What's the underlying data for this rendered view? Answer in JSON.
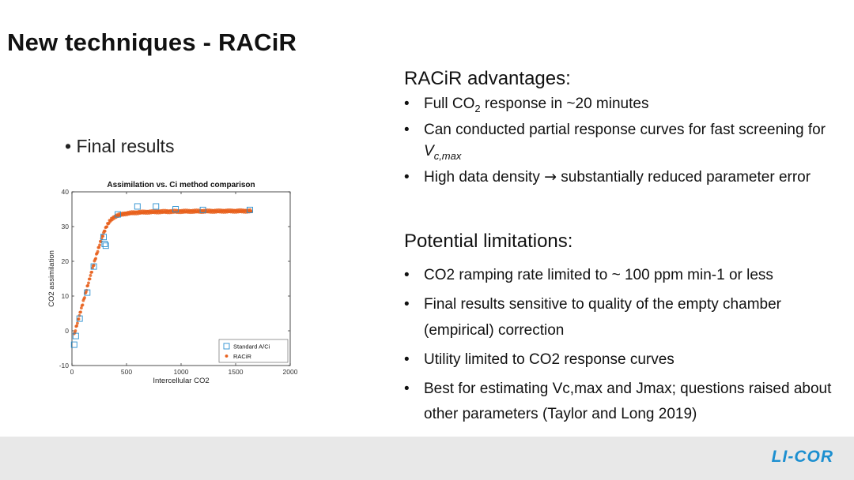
{
  "slide": {
    "title": "New techniques - RACiR",
    "left_bullet": "Final results"
  },
  "advantages": {
    "heading": "RACiR advantages:",
    "items": [
      {
        "pre": "Full CO",
        "sub": "2",
        "post": " response in ~20 minutes"
      },
      {
        "pre": "Can conducted partial response curves for fast screening for ",
        "ital": "V",
        "ital_sub": "c,max"
      },
      {
        "pre": "High data density ",
        "arrow": "→",
        "post": " substantially reduced parameter error"
      }
    ]
  },
  "limitations": {
    "heading": "Potential limitations:",
    "items": [
      "CO2 ramping rate limited to ~ 100 ppm min-1 or less",
      "Final results sensitive to quality of the empty chamber (empirical) correction",
      "Utility limited to CO2 response curves",
      "Best for estimating Vc,max and Jmax; questions raised about other parameters (Taylor and Long 2019)"
    ]
  },
  "footer": {
    "logo_text": "LI-COR",
    "color": "#1c8fd0"
  },
  "chart_data": {
    "type": "scatter",
    "title": "Assimilation vs. Ci method comparison",
    "xlabel": "Intercellular CO2",
    "ylabel": "CO2 assimilation",
    "xlim": [
      0,
      2000
    ],
    "ylim": [
      -10,
      40
    ],
    "xticks": [
      "0",
      "500",
      "1000",
      "1500",
      "2000"
    ],
    "yticks": [
      "-10",
      "0",
      "10",
      "20",
      "30",
      "40"
    ],
    "legend_position": "bottom-right",
    "grid": false,
    "series": [
      {
        "name": "Standard A/Ci",
        "marker": "square",
        "color": "#2a8fd0",
        "x": [
          20,
          35,
          70,
          140,
          200,
          290,
          300,
          310,
          420,
          600,
          770,
          950,
          1200,
          1630
        ],
        "y": [
          -4,
          -1.5,
          3.5,
          11,
          18.5,
          27,
          25,
          24.5,
          33.5,
          35.8,
          35.8,
          35,
          34.8,
          34.8
        ]
      },
      {
        "name": "RACiR",
        "marker": "dot",
        "color": "#e8601c",
        "curve": {
          "x0": 30,
          "slope": 0.115,
          "amax": 34.6,
          "theta": 0.985,
          "x_end": 1650
        }
      }
    ]
  }
}
